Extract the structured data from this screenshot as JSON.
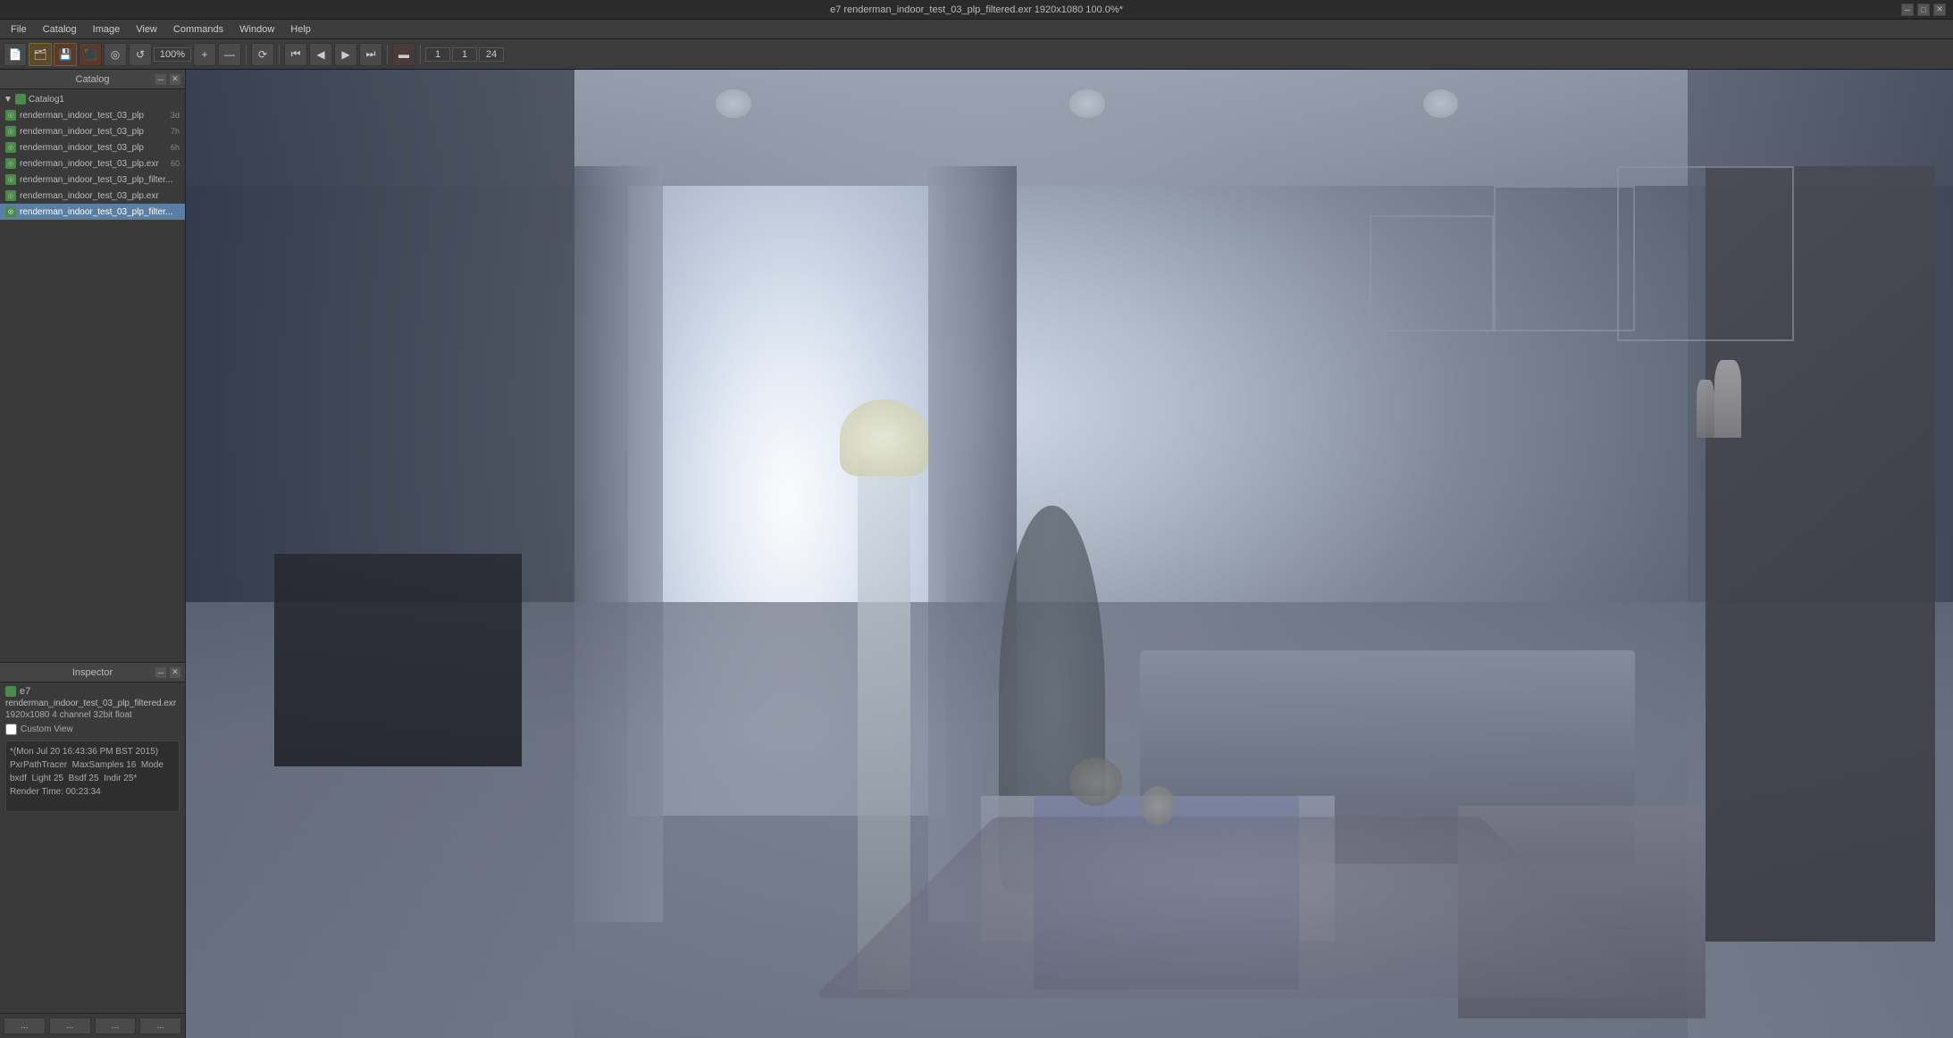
{
  "title_bar": {
    "title": "e7 renderman_indoor_test_03_plp_filtered.exr 1920x1080 100.0%*",
    "close_btn": "✕",
    "min_btn": "─",
    "max_btn": "□"
  },
  "menu": {
    "items": [
      "File",
      "Catalog",
      "Image",
      "View",
      "Commands",
      "Window",
      "Help"
    ]
  },
  "toolbar": {
    "zoom_label": "100%",
    "frame_start": "1",
    "frame_current": "1",
    "frame_end": "24"
  },
  "catalog": {
    "title": "Catalog",
    "group": "Catalog1",
    "items": [
      {
        "name": "renderman_indoor_test_03_plp",
        "time": "3d",
        "active": false
      },
      {
        "name": "renderman_indoor_test_03_plp",
        "time": "7h",
        "active": false
      },
      {
        "name": "renderman_indoor_test_03_plp",
        "time": "6h",
        "active": false
      },
      {
        "name": "renderman_indoor_test_03_plp.exr",
        "time": "60",
        "active": false
      },
      {
        "name": "renderman_indoor_test_03_plp_filter...",
        "time": "",
        "active": false
      },
      {
        "name": "renderman_indoor_test_03_plp.exr",
        "time": "",
        "active": false
      },
      {
        "name": "renderman_indoor_test_03_plp_filter...",
        "time": "",
        "active": true
      }
    ]
  },
  "inspector": {
    "title": "Inspector",
    "session_name": "e7",
    "filename": "renderman_indoor_test_03_plp_filtered.exr",
    "info": "1920x1080 4 channel 32bit float",
    "custom_view_label": "Custom View",
    "notes": "*(Mon Jul 20 16:43:36 PM BST 2015)\nPxrPathTracer  MaxSamples 16  Mode bxdf  Light 25  Bsdf 25  Indir 25*\nRender Time: 00:23:34"
  },
  "inspector_footer": {
    "btn1": "...",
    "btn2": "...",
    "btn3": "...",
    "btn4": "..."
  }
}
